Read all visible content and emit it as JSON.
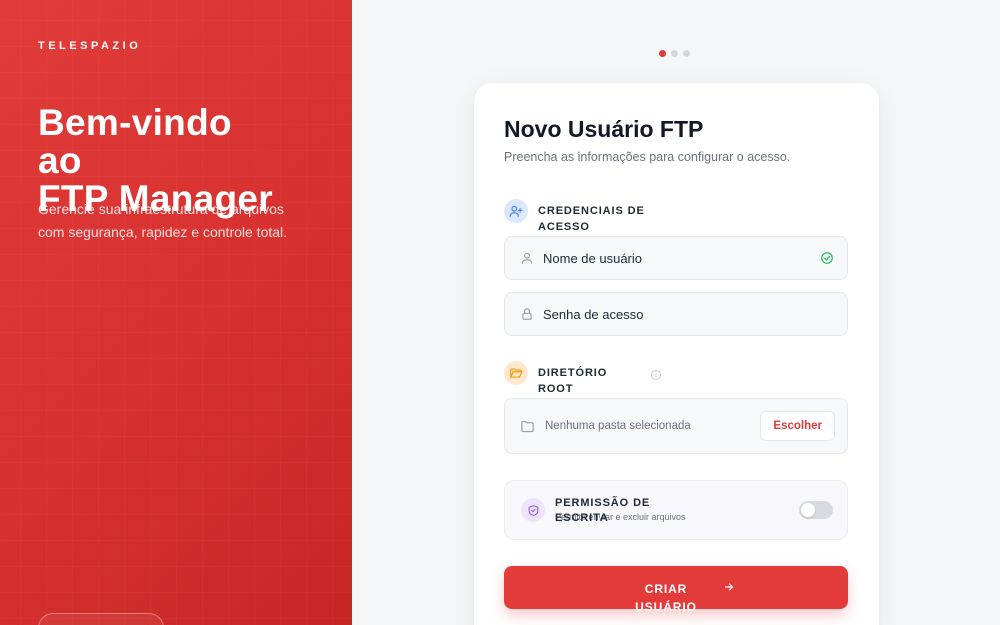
{
  "brand": "TELESPAZIO",
  "hero": {
    "title_line1": "Bem-vindo",
    "title_line2": "ao",
    "title_line3": "FTP Manager",
    "description": "Gerencie sua infraestrutura de arquivos com segurança, rapidez e controle total."
  },
  "steps": {
    "total": 3,
    "active": 1
  },
  "form": {
    "title": "Novo Usuário FTP",
    "subtitle": "Preencha as informações para configurar o acesso.",
    "credentials": {
      "section_label": "CREDENCIAIS DE ACESSO",
      "username_placeholder": "Nome de usuário",
      "password_placeholder": "Senha de acesso"
    },
    "directory": {
      "section_label": "DIRETÓRIO ROOT",
      "empty_text": "Nenhuma pasta selecionada",
      "choose_label": "Escolher"
    },
    "permission": {
      "section_label": "PERMISSÃO DE ESCRITA",
      "description": "Permitir enviar e excluir arquivos",
      "enabled": false
    },
    "submit_label": "CRIAR USUÁRIO"
  },
  "colors": {
    "accent": "#e23b39",
    "success": "#22c55e",
    "info_blue": "#3b82f6",
    "folder_orange": "#f59e0b",
    "shield_purple": "#8b5cf6"
  },
  "icons": {
    "credentials": "user-plus-icon",
    "username": "user-icon",
    "password": "lock-icon",
    "valid": "check-circle-icon",
    "directory": "folder-open-icon",
    "info": "info-icon",
    "folder": "folder-icon",
    "permission": "shield-check-icon",
    "submit": "arrow-right-icon"
  }
}
